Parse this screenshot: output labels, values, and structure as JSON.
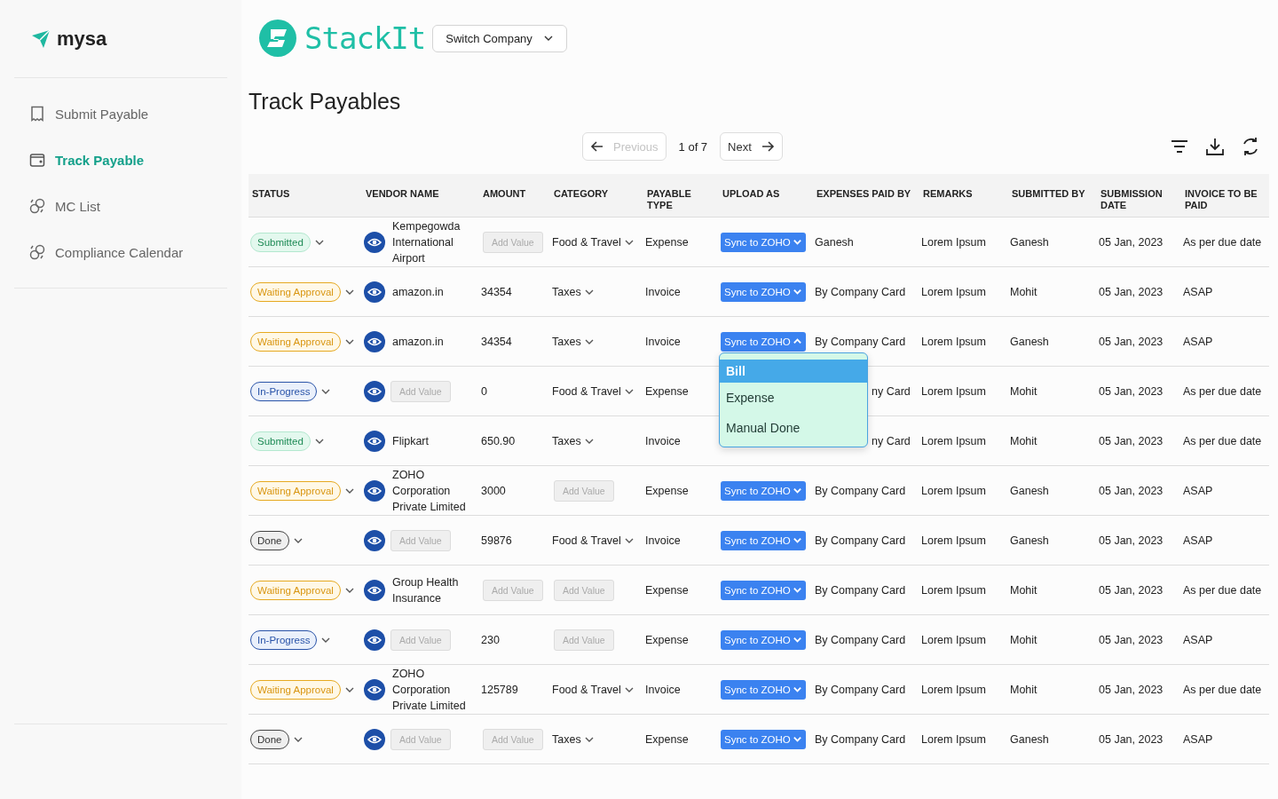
{
  "brand": {
    "name": "mysa"
  },
  "sidebar": {
    "items": [
      {
        "label": "Submit Payable",
        "selected": false
      },
      {
        "label": "Track Payable",
        "selected": true
      },
      {
        "label": "MC List",
        "selected": false
      },
      {
        "label": "Compliance Calendar",
        "selected": false
      }
    ]
  },
  "company": {
    "name": "StackIt",
    "switch_label": "Switch Company"
  },
  "title": "Track Payables",
  "pagination": {
    "previous": {
      "label": "Previous",
      "disabled": true
    },
    "page": "1 of 7",
    "next": {
      "label": "Next",
      "disabled": false
    }
  },
  "table": {
    "columns": [
      "STATUS",
      "VENDOR NAME",
      "AMOUNT",
      "CATEGORY",
      "PAYABLE TYPE",
      "UPLOAD AS",
      "EXPENSES PAID BY",
      "REMARKS",
      "SUBMITTED BY",
      "SUBMISSION DATE",
      "INVOICE TO BE PAID"
    ],
    "rows": [
      {
        "status": {
          "kind": "submitted",
          "label": "Submitted"
        },
        "vendor": {
          "kind": "text",
          "text": "Kempegowda International Airport"
        },
        "amount": {
          "kind": "add",
          "text": "Add Value"
        },
        "category": {
          "kind": "select",
          "text": "Food & Travel"
        },
        "payable_type": "Expense",
        "upload": {
          "label": "Sync to ZOHO",
          "expanded": false
        },
        "expenses_paid_by": "Ganesh",
        "remarks": "Lorem Ipsum",
        "submitted_by": "Ganesh",
        "date": "05 Jan, 2023",
        "invoice": "As per due date"
      },
      {
        "status": {
          "kind": "waiting",
          "label": "Waiting Approval"
        },
        "vendor": {
          "kind": "text",
          "text": "amazon.in"
        },
        "amount": {
          "kind": "text",
          "text": "34354"
        },
        "category": {
          "kind": "select",
          "text": "Taxes"
        },
        "payable_type": "Invoice",
        "upload": {
          "label": "Sync to ZOHO",
          "expanded": false
        },
        "expenses_paid_by": "By Company Card",
        "remarks": "Lorem Ipsum",
        "submitted_by": "Mohit",
        "date": "05 Jan, 2023",
        "invoice": "ASAP"
      },
      {
        "status": {
          "kind": "waiting",
          "label": "Waiting Approval"
        },
        "vendor": {
          "kind": "text",
          "text": "amazon.in"
        },
        "amount": {
          "kind": "text",
          "text": "34354"
        },
        "category": {
          "kind": "select",
          "text": "Taxes"
        },
        "payable_type": "Invoice",
        "upload": {
          "label": "Sync to ZOHO",
          "expanded": true,
          "options": [
            {
              "label": "Bill",
              "selected": true
            },
            {
              "label": "Expense",
              "selected": false
            },
            {
              "label": "Manual Done",
              "selected": false
            }
          ]
        },
        "expenses_paid_by": "By Company Card",
        "remarks": "Lorem Ipsum",
        "submitted_by": "Ganesh",
        "date": "05 Jan, 2023",
        "invoice": "ASAP"
      },
      {
        "status": {
          "kind": "progress",
          "label": "In-Progress"
        },
        "vendor": {
          "kind": "add",
          "text": "Add Value"
        },
        "amount": {
          "kind": "text",
          "text": "0"
        },
        "category": {
          "kind": "select",
          "text": "Food & Travel"
        },
        "payable_type": "Expense",
        "expenses_paid_by": "ny Card",
        "remarks": "Lorem Ipsum",
        "submitted_by": "Mohit",
        "date": "05 Jan, 2023",
        "invoice": "As per due date"
      },
      {
        "status": {
          "kind": "submitted",
          "label": "Submitted"
        },
        "vendor": {
          "kind": "text",
          "text": "Flipkart"
        },
        "amount": {
          "kind": "text",
          "text": "650.90"
        },
        "category": {
          "kind": "select",
          "text": "Taxes"
        },
        "payable_type": "Invoice",
        "expenses_paid_by": "ny Card",
        "remarks": "Lorem Ipsum",
        "submitted_by": "Mohit",
        "date": "05 Jan, 2023",
        "invoice": "As per due date"
      },
      {
        "status": {
          "kind": "waiting",
          "label": "Waiting Approval"
        },
        "vendor": {
          "kind": "text",
          "text": "ZOHO Corporation Private Limited"
        },
        "amount": {
          "kind": "text",
          "text": "3000"
        },
        "category": {
          "kind": "add",
          "text": "Add Value"
        },
        "payable_type": "Expense",
        "upload": {
          "label": "Sync to ZOHO",
          "expanded": false
        },
        "expenses_paid_by": "By Company Card",
        "remarks": "Lorem Ipsum",
        "submitted_by": "Ganesh",
        "date": "05 Jan, 2023",
        "invoice": "ASAP"
      },
      {
        "status": {
          "kind": "done",
          "label": "Done"
        },
        "vendor": {
          "kind": "add",
          "text": "Add Value"
        },
        "amount": {
          "kind": "text",
          "text": "59876"
        },
        "category": {
          "kind": "select",
          "text": "Food & Travel"
        },
        "payable_type": "Invoice",
        "upload": {
          "label": "Sync to ZOHO",
          "expanded": false
        },
        "expenses_paid_by": "By Company Card",
        "remarks": "Lorem Ipsum",
        "submitted_by": "Ganesh",
        "date": "05 Jan, 2023",
        "invoice": "ASAP"
      },
      {
        "status": {
          "kind": "waiting",
          "label": "Waiting Approval"
        },
        "vendor": {
          "kind": "text",
          "text": "Group Health Insurance"
        },
        "amount": {
          "kind": "add",
          "text": "Add Value"
        },
        "category": {
          "kind": "add",
          "text": "Add Value"
        },
        "payable_type": "Expense",
        "upload": {
          "label": "Sync to ZOHO",
          "expanded": false
        },
        "expenses_paid_by": "By Company Card",
        "remarks": "Lorem Ipsum",
        "submitted_by": "Mohit",
        "date": "05 Jan, 2023",
        "invoice": "As per due date"
      },
      {
        "status": {
          "kind": "progress",
          "label": "In-Progress"
        },
        "vendor": {
          "kind": "add",
          "text": "Add Value"
        },
        "amount": {
          "kind": "text",
          "text": "230"
        },
        "category": {
          "kind": "add",
          "text": "Add Value"
        },
        "payable_type": "Expense",
        "upload": {
          "label": "Sync to ZOHO",
          "expanded": false
        },
        "expenses_paid_by": "By Company Card",
        "remarks": "Lorem Ipsum",
        "submitted_by": "Mohit",
        "date": "05 Jan, 2023",
        "invoice": "ASAP"
      },
      {
        "status": {
          "kind": "waiting",
          "label": "Waiting Approval"
        },
        "vendor": {
          "kind": "text",
          "text": "ZOHO Corporation Private Limited"
        },
        "amount": {
          "kind": "text",
          "text": "125789"
        },
        "category": {
          "kind": "select",
          "text": "Food & Travel"
        },
        "payable_type": "Invoice",
        "upload": {
          "label": "Sync to ZOHO",
          "expanded": false
        },
        "expenses_paid_by": "By Company Card",
        "remarks": "Lorem Ipsum",
        "submitted_by": "Mohit",
        "date": "05 Jan, 2023",
        "invoice": "As per due date"
      },
      {
        "status": {
          "kind": "done",
          "label": "Done"
        },
        "vendor": {
          "kind": "add",
          "text": "Add Value"
        },
        "amount": {
          "kind": "add",
          "text": "Add Value"
        },
        "category": {
          "kind": "select",
          "text": "Taxes"
        },
        "payable_type": "Expense",
        "upload": {
          "label": "Sync to ZOHO",
          "expanded": false
        },
        "expenses_paid_by": "By Company Card",
        "remarks": "Lorem Ipsum",
        "submitted_by": "Ganesh",
        "date": "05 Jan, 2023",
        "invoice": "ASAP"
      }
    ]
  }
}
